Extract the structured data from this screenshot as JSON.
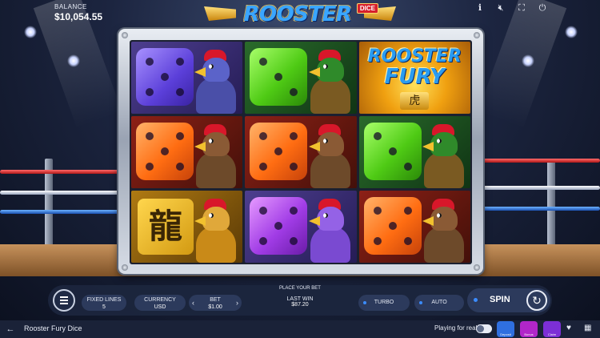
{
  "header": {
    "balance_label": "BALANCE",
    "balance_value": "$10,054.55",
    "logo_text": "ROOSTER FURY",
    "logo_badge": "DICE",
    "icons": [
      "info-icon",
      "mute-icon",
      "fullscreen-icon",
      "power-icon"
    ]
  },
  "reels": {
    "grid": [
      [
        "purple-die-rooster",
        "green-die-rooster",
        "rooster-fury-logo"
      ],
      [
        "orange-die-rooster",
        "orange-die-rooster",
        "green-die-rooster"
      ],
      [
        "dragon-glyph-rooster",
        "violet-die-rooster",
        "orange-die-rooster"
      ]
    ],
    "logo_symbol": {
      "line1": "ROOSTER",
      "line2": "FURY",
      "kanji": "虎"
    },
    "glyph_symbol": {
      "kanji": "龍"
    }
  },
  "controls": {
    "fixed_lines_label": "FIXED LINES",
    "fixed_lines_value": "5",
    "currency_label": "CURRENCY",
    "currency_value": "USD",
    "bet_label": "BET",
    "bet_value": "$1.00",
    "prev_arrow": "‹",
    "next_arrow": "›",
    "place_your_bet": "PLACE YOUR BET",
    "last_win_label": "LAST WIN",
    "last_win_value": "$87.20",
    "turbo_label": "TURBO",
    "auto_label": "AUTO",
    "spin_label": "SPIN"
  },
  "footer": {
    "game_title": "Rooster Fury Dice",
    "playing_for_real_label": "Playing for real",
    "promos": [
      {
        "name": "bonus-deposit-promo",
        "label": "Deposit",
        "color": "#2f6fe0"
      },
      {
        "name": "bonus-promo",
        "label": "Bonus",
        "color": "#b126c9"
      },
      {
        "name": "jackpot-claim-promo",
        "label": "Claim",
        "color": "#7c2fd6"
      }
    ]
  }
}
